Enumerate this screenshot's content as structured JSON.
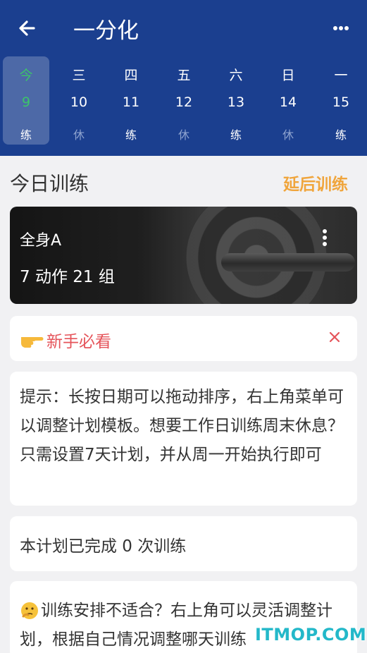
{
  "header": {
    "title": "一分化",
    "back_icon": "arrow-left-icon",
    "more_icon": "more-horizontal-icon",
    "background": "#1b3f8f"
  },
  "week": [
    {
      "weekday": "今",
      "date": "9",
      "status": "练",
      "selected": true
    },
    {
      "weekday": "三",
      "date": "10",
      "status": "休",
      "selected": false
    },
    {
      "weekday": "四",
      "date": "11",
      "status": "练",
      "selected": false
    },
    {
      "weekday": "五",
      "date": "12",
      "status": "休",
      "selected": false
    },
    {
      "weekday": "六",
      "date": "13",
      "status": "练",
      "selected": false
    },
    {
      "weekday": "日",
      "date": "14",
      "status": "休",
      "selected": false
    },
    {
      "weekday": "一",
      "date": "15",
      "status": "练",
      "selected": false
    }
  ],
  "today": {
    "title": "今日训练",
    "postpone_label": "延后训练",
    "accent": "#f0a53c"
  },
  "workout": {
    "name": "全身A",
    "summary": "7 动作 21 组",
    "menu_icon": "more-vertical-icon"
  },
  "newbie": {
    "icon": "pointing-hand-icon",
    "label": "新手必看",
    "close_icon": "close-icon",
    "color": "#e5545a"
  },
  "tip": {
    "text": "提示：长按日期可以拖动排序，右上角菜单可以调整计划模板。想要工作日训练周末休息？只需设置7天计划，并从周一开始执行即可"
  },
  "progress": {
    "text": "本计划已完成 0 次训练"
  },
  "advice": {
    "icon": "thinking-face-icon",
    "text": "训练安排不适合？右上角可以灵活调整计划，根据自己情况调整哪天训练"
  },
  "watermark": "ITMOP.COM"
}
